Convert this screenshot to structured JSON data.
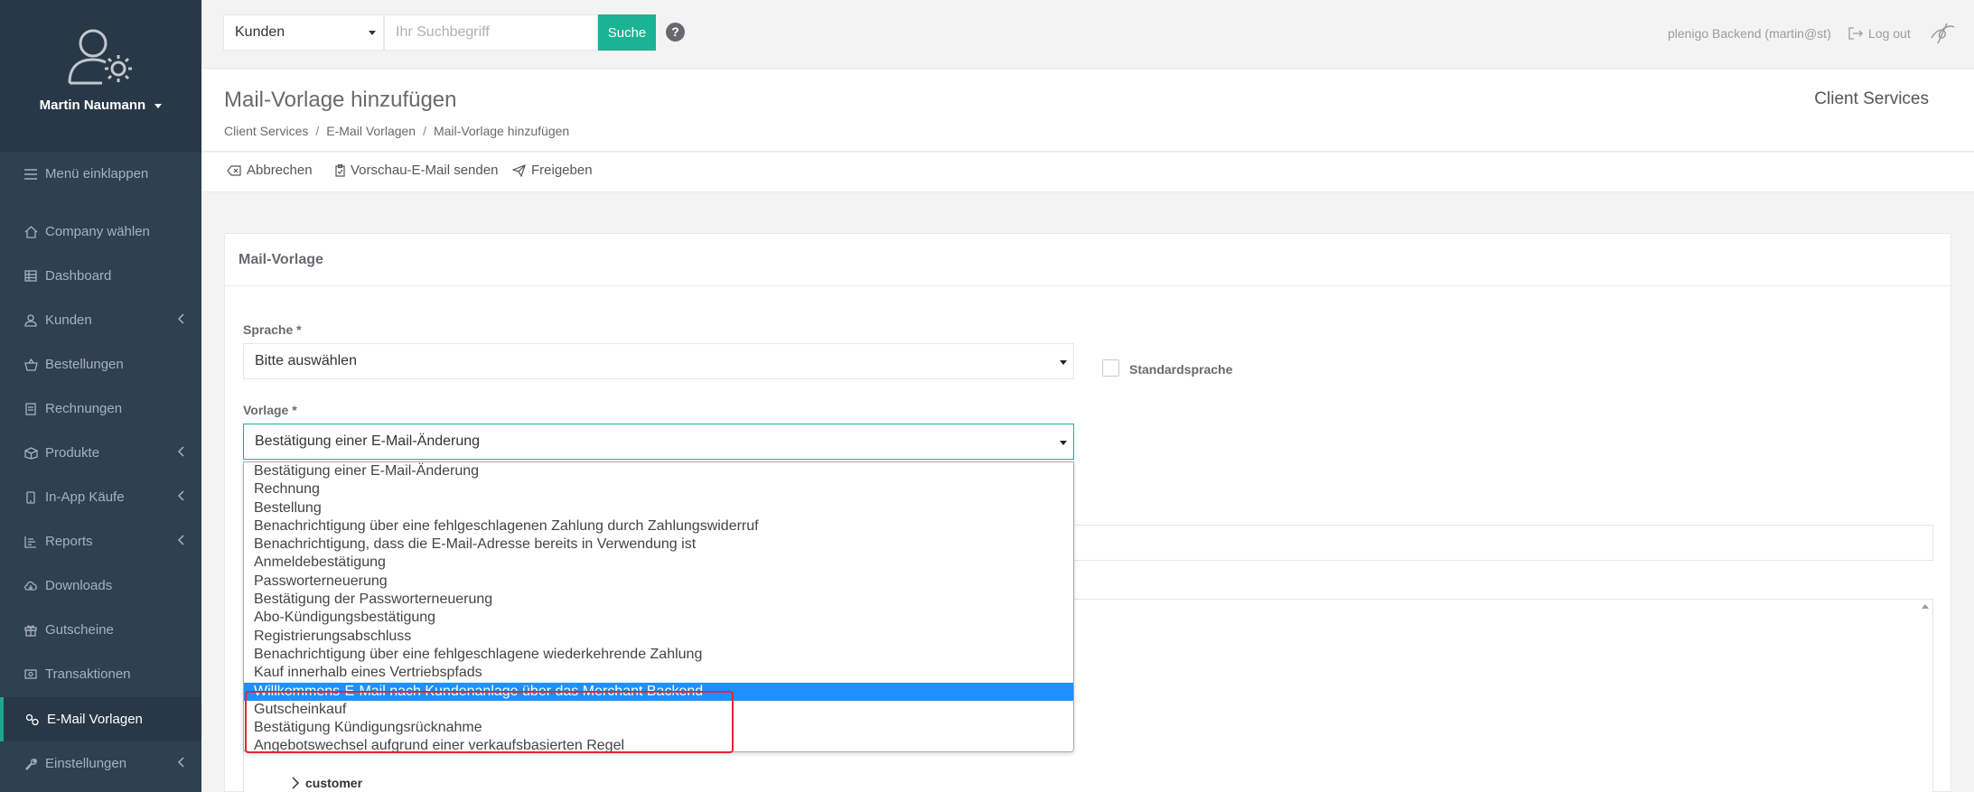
{
  "sidebar": {
    "username": "Martin Naumann",
    "collapse_label": "Menü einklappen",
    "items": [
      {
        "label": "Company wählen",
        "icon": "home-icon",
        "has_children": false
      },
      {
        "label": "Dashboard",
        "icon": "table-icon",
        "has_children": false
      },
      {
        "label": "Kunden",
        "icon": "user-icon",
        "has_children": true
      },
      {
        "label": "Bestellungen",
        "icon": "basket-icon",
        "has_children": false
      },
      {
        "label": "Rechnungen",
        "icon": "invoice-icon",
        "has_children": false
      },
      {
        "label": "Produkte",
        "icon": "box-icon",
        "has_children": true
      },
      {
        "label": "In-App Käufe",
        "icon": "phone-icon",
        "has_children": true
      },
      {
        "label": "Reports",
        "icon": "reports-icon",
        "has_children": true
      },
      {
        "label": "Downloads",
        "icon": "cloud-download-icon",
        "has_children": false
      },
      {
        "label": "Gutscheine",
        "icon": "gift-icon",
        "has_children": false
      },
      {
        "label": "Transaktionen",
        "icon": "cash-icon",
        "has_children": false
      },
      {
        "label": "E-Mail Vorlagen",
        "icon": "mail-templates-icon",
        "has_children": false,
        "active": true
      },
      {
        "label": "Einstellungen",
        "icon": "wrench-icon",
        "has_children": true
      }
    ]
  },
  "topbar": {
    "search_scope": "Kunden",
    "search_placeholder": "Ihr Suchbegriff",
    "search_button": "Suche",
    "help": "?",
    "user_label": "plenigo Backend (martin@st)",
    "logout_label": "Log out"
  },
  "heading": {
    "title": "Mail-Vorlage hinzufügen",
    "breadcrumbs": [
      "Client Services",
      "E-Mail Vorlagen",
      "Mail-Vorlage hinzufügen"
    ],
    "client": "Client Services"
  },
  "toolbar": {
    "cancel": "Abbrechen",
    "preview": "Vorschau-E-Mail senden",
    "release": "Freigeben"
  },
  "form": {
    "panel_title": "Mail-Vorlage",
    "language_label": "Sprache *",
    "language_value": "Bitte auswählen",
    "default_language_label": "Standardsprache",
    "template_label": "Vorlage *",
    "template_value": "Bestätigung einer E-Mail-Änderung",
    "tree_node": "customer"
  },
  "dropdown": {
    "options": [
      "Bestätigung einer E-Mail-Änderung",
      "Rechnung",
      "Bestellung",
      "Benachrichtigung über eine fehlgeschlagenen Zahlung durch Zahlungswiderruf",
      "Benachrichtigung, dass die E-Mail-Adresse bereits in Verwendung ist",
      "Anmeldebestätigung",
      "Passworterneuerung",
      "Bestätigung der Passworterneuerung",
      "Abo-Kündigungsbestätigung",
      "Registrierungsabschluss",
      "Benachrichtigung über eine fehlgeschlagene wiederkehrende Zahlung",
      "Kauf innerhalb eines Vertriebspfads",
      "Willkommens-E-Mail nach Kundenanlage über das Merchant Backend",
      "Gutscheinkauf",
      "Bestätigung Kündigungsrücknahme",
      "Angebotswechsel aufgrund einer verkaufsbasierten Regel"
    ],
    "selected_index": 12
  },
  "colors": {
    "sidebar_bg": "#2f4050",
    "accent": "#1ab394",
    "selection": "#1e90ff",
    "highlight_border": "#e3262f"
  }
}
